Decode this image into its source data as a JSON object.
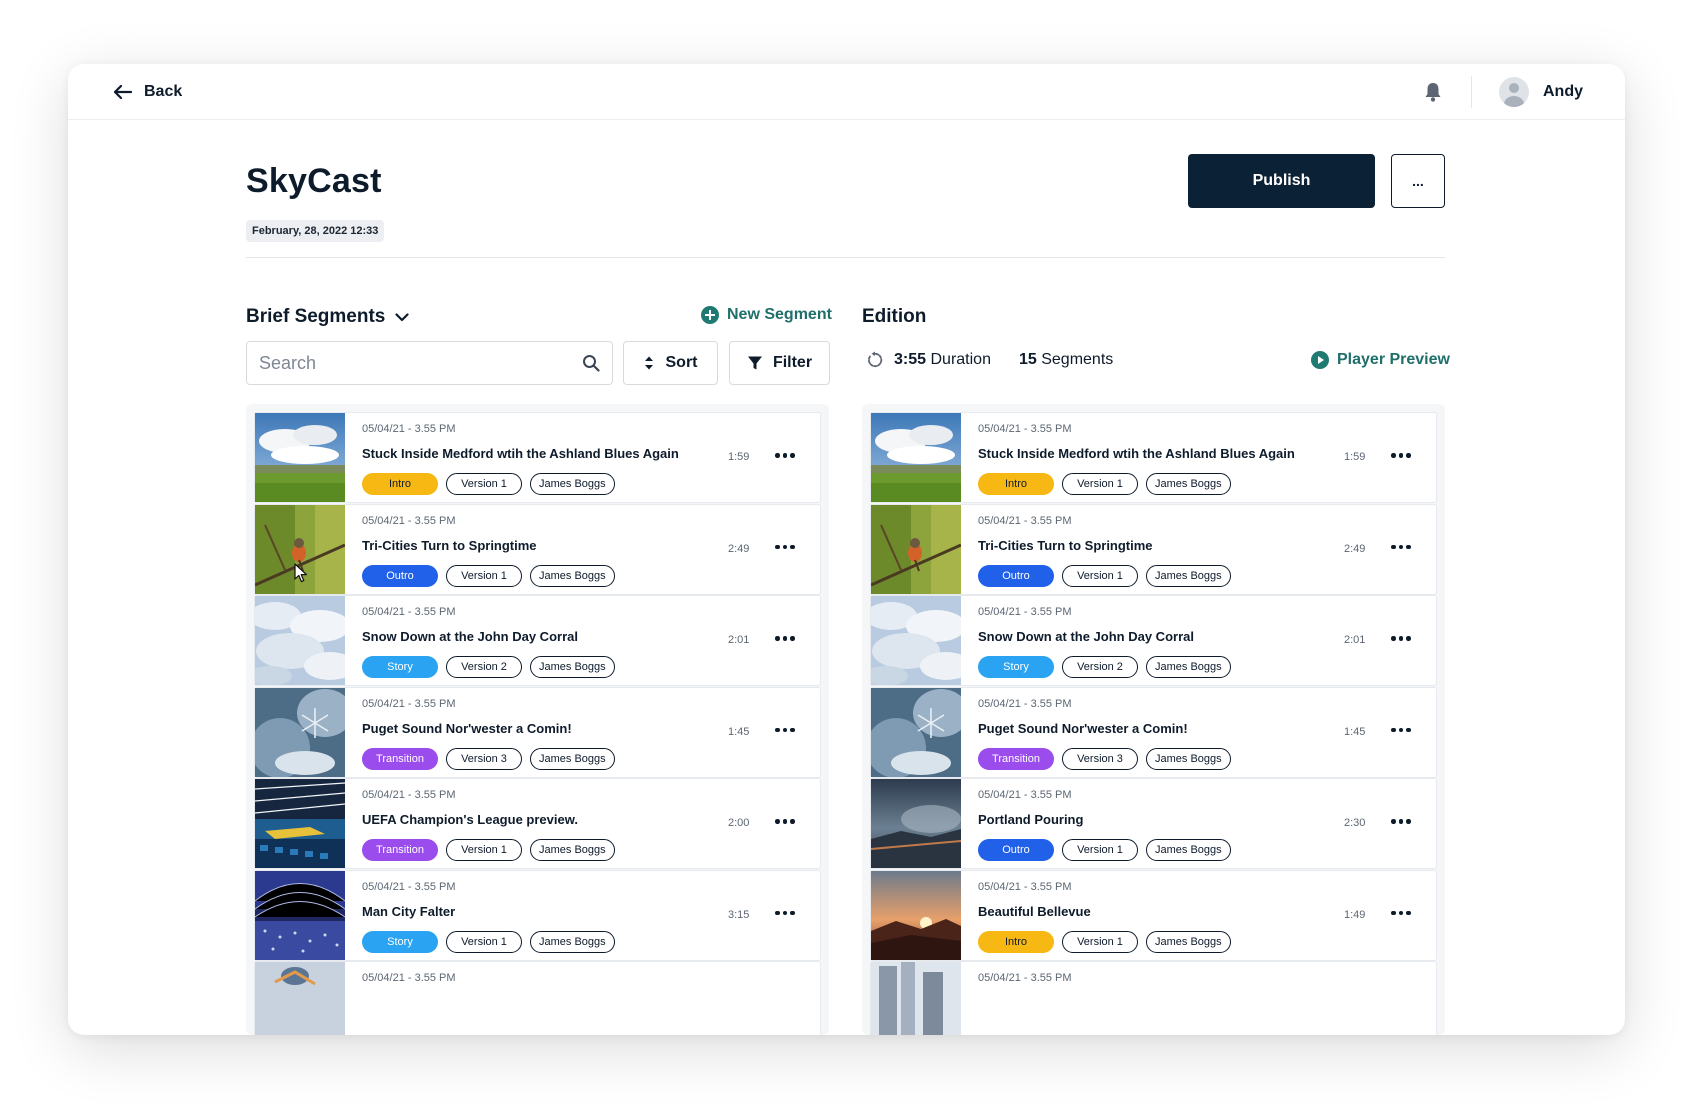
{
  "nav": {
    "back_label": "Back",
    "user_name": "Andy"
  },
  "header": {
    "title": "SkyCast",
    "date": "February, 28, 2022 12:33",
    "publish_label": "Publish",
    "more_label": "..."
  },
  "brief": {
    "title": "Brief Segments",
    "new_segment_label": "New Segment",
    "search_placeholder": "Search",
    "sort_label": "Sort",
    "filter_label": "Filter"
  },
  "edition": {
    "title": "Edition",
    "duration_value": "3:55",
    "duration_label": "Duration",
    "segments_count": "15",
    "segments_label": "Segments",
    "player_preview_label": "Player Preview"
  },
  "colors": {
    "Intro": "#f7b814",
    "Outro": "#2160e8",
    "Story": "#2aa3f2",
    "Transition": "#9b4cec",
    "teal": "#1f6f6b",
    "navy": "#0b2135"
  },
  "brief_segments": [
    {
      "date": "05/04/21 - 3.55 PM",
      "title": "Stuck Inside Medford wtih the Ashland Blues Again",
      "category": "Intro",
      "version": "Version 1",
      "author": "James Boggs",
      "duration": "1:59",
      "thumb": "meadow-sky"
    },
    {
      "date": "05/04/21 - 3.55 PM",
      "title": "Tri-Cities Turn to Springtime",
      "category": "Outro",
      "version": "Version 1",
      "author": "James Boggs",
      "duration": "2:49",
      "thumb": "robin-branch"
    },
    {
      "date": "05/04/21 - 3.55 PM",
      "title": "Snow Down at the John Day Corral",
      "category": "Story",
      "version": "Version 2",
      "author": "James Boggs",
      "duration": "2:01",
      "thumb": "clouds"
    },
    {
      "date": "05/04/21 - 3.55 PM",
      "title": "Puget Sound Nor'wester a Comin!",
      "category": "Transition",
      "version": "Version 3",
      "author": "James Boggs",
      "duration": "1:45",
      "thumb": "snowflake"
    },
    {
      "date": "05/04/21 - 3.55 PM",
      "title": "UEFA Champion's League preview.",
      "category": "Transition",
      "version": "Version 1",
      "author": "James Boggs",
      "duration": "2:00",
      "thumb": "stadium-seats"
    },
    {
      "date": "05/04/21 - 3.55 PM",
      "title": "Man City Falter",
      "category": "Story",
      "version": "Version 1",
      "author": "James Boggs",
      "duration": "3:15",
      "thumb": "stadium-lights"
    },
    {
      "date": "05/04/21 - 3.55 PM",
      "title": "",
      "category": "",
      "version": "",
      "author": "",
      "duration": "",
      "thumb": "bird-sky"
    }
  ],
  "edition_segments": [
    {
      "date": "05/04/21 - 3.55 PM",
      "title": "Stuck Inside Medford wtih the Ashland Blues Again",
      "category": "Intro",
      "version": "Version 1",
      "author": "James Boggs",
      "duration": "1:59",
      "thumb": "meadow-sky"
    },
    {
      "date": "05/04/21 - 3.55 PM",
      "title": "Tri-Cities Turn to Springtime",
      "category": "Outro",
      "version": "Version 1",
      "author": "James Boggs",
      "duration": "2:49",
      "thumb": "robin-branch"
    },
    {
      "date": "05/04/21 - 3.55 PM",
      "title": "Snow Down at the John Day Corral",
      "category": "Story",
      "version": "Version 2",
      "author": "James Boggs",
      "duration": "2:01",
      "thumb": "clouds"
    },
    {
      "date": "05/04/21 - 3.55 PM",
      "title": "Puget Sound Nor'wester a Comin!",
      "category": "Transition",
      "version": "Version 3",
      "author": "James Boggs",
      "duration": "1:45",
      "thumb": "snowflake"
    },
    {
      "date": "05/04/21 - 3.55 PM",
      "title": "Portland Pouring",
      "category": "Outro",
      "version": "Version 1",
      "author": "James Boggs",
      "duration": "2:30",
      "thumb": "storm-sea"
    },
    {
      "date": "05/04/21 - 3.55 PM",
      "title": "Beautiful Bellevue",
      "category": "Intro",
      "version": "Version 1",
      "author": "James Boggs",
      "duration": "1:49",
      "thumb": "sunset-hills"
    },
    {
      "date": "05/04/21 - 3.55 PM",
      "title": "",
      "category": "",
      "version": "",
      "author": "",
      "duration": "",
      "thumb": "city-buildings"
    }
  ]
}
